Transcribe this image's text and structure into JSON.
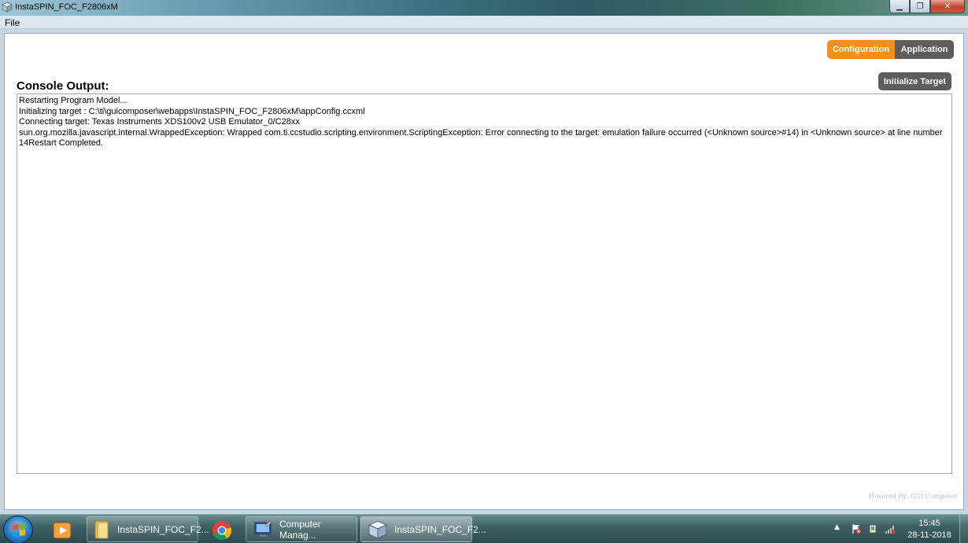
{
  "window": {
    "title": "InstaSPIN_FOC_F2806xM",
    "minimize_symbol": "▁",
    "maximize_symbol": "❐",
    "close_symbol": "✕"
  },
  "menu": {
    "file_label": "File"
  },
  "tabs": {
    "configuration_label": "Configuration",
    "application_label": "Application",
    "active": "Configuration"
  },
  "console": {
    "title": "Console Output:",
    "lines": [
      "Restarting Program Model...",
      "Initializing target : C:\\ti\\guicomposer\\webapps\\InstaSPIN_FOC_F2806xM\\appConfig.ccxml",
      "Connecting target: Texas Instruments XDS100v2 USB Emulator_0/C28xx",
      "sun.org.mozilla.javascript.internal.WrappedException: Wrapped com.ti.ccstudio.scripting.environment.ScriptingException: Error connecting to the target: emulation failure occurred (<Unknown source>#14) in <Unknown source> at line number 14Restart Completed."
    ]
  },
  "buttons": {
    "initialize_target_label": "Initialize Target"
  },
  "footer": {
    "powered_by": "Powered By: GUI Composer"
  },
  "taskbar": {
    "tasks": [
      {
        "label": "InstaSPIN_FOC_F2...",
        "icon": "folder-icon"
      },
      {
        "label": "Computer Manag...",
        "icon": "computer-management-icon"
      },
      {
        "label": "InstaSPIN_FOC_F2...",
        "icon": "gui-composer-icon",
        "active": true
      }
    ],
    "clock_time": "15:45",
    "clock_date": "28-11-2018",
    "tray_arrow": "▲"
  },
  "colors": {
    "accent_orange": "#f39016",
    "tab_gray": "#5d5d5d"
  }
}
